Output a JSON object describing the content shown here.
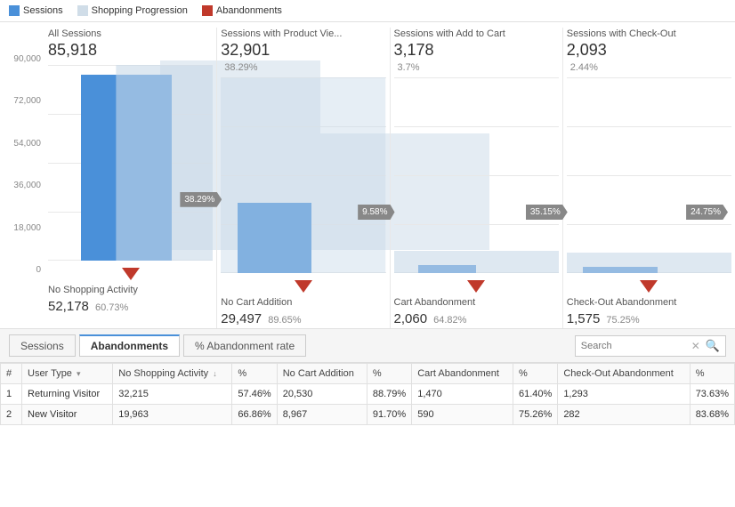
{
  "legend": {
    "sessions_label": "Sessions",
    "shopping_label": "Shopping Progression",
    "abandonment_label": "Abandonments"
  },
  "y_axis": [
    "90,000",
    "72,000",
    "54,000",
    "36,000",
    "18,000",
    "0"
  ],
  "columns": [
    {
      "header": "All Sessions",
      "count": "85,918",
      "pct": "",
      "bar_height_pct": 95,
      "funnel_pct": null,
      "arrow_label": null,
      "bottom_label": "No Shopping Activity",
      "bottom_count": "52,178",
      "bottom_pct": "60.73%",
      "abandon_pct": "38.29%"
    },
    {
      "header": "Sessions with Product Vie...",
      "count": "32,901",
      "pct": "38.29%",
      "bar_height_pct": 36,
      "funnel_pct": null,
      "arrow_label": "9.58%",
      "bottom_label": "No Cart Addition",
      "bottom_count": "29,497",
      "bottom_pct": "89.65%",
      "abandon_pct": "9.58%"
    },
    {
      "header": "Sessions with Add to Cart",
      "count": "3,178",
      "pct": "3.7%",
      "bar_height_pct": 4,
      "funnel_pct": null,
      "arrow_label": "35.15%",
      "bottom_label": "Cart Abandonment",
      "bottom_count": "2,060",
      "bottom_pct": "64.82%",
      "abandon_pct": "35.15%"
    },
    {
      "header": "Sessions with Check-Out",
      "count": "2,093",
      "pct": "2.44%",
      "bar_height_pct": 3,
      "funnel_pct": null,
      "arrow_label": "24.75%",
      "bottom_label": "Check-Out Abandonment",
      "bottom_count": "1,575",
      "bottom_pct": "75.25%",
      "abandon_pct": "24.75%"
    }
  ],
  "tabs": [
    "Sessions",
    "Abandonments",
    "% Abandonment rate"
  ],
  "active_tab": "Abandonments",
  "search_placeholder": "Search",
  "table": {
    "headers": [
      "#",
      "User Type",
      "No Shopping Activity",
      "",
      "No Cart Addition",
      "%",
      "Cart Abandonment",
      "%",
      "Check-Out Abandonment",
      "%"
    ],
    "sort_col": "No Shopping Activity",
    "rows": [
      {
        "num": "1",
        "user_type": "Returning Visitor",
        "no_shopping": "32,215",
        "no_shopping_pct": "57.46%",
        "no_cart": "20,530",
        "no_cart_pct": "88.79%",
        "cart_abandon": "1,470",
        "cart_abandon_pct": "61.40%",
        "checkout_abandon": "1,293",
        "checkout_abandon_pct": "73.63%"
      },
      {
        "num": "2",
        "user_type": "New Visitor",
        "no_shopping": "19,963",
        "no_shopping_pct": "66.86%",
        "no_cart": "8,967",
        "no_cart_pct": "91.70%",
        "cart_abandon": "590",
        "cart_abandon_pct": "75.26%",
        "checkout_abandon": "282",
        "checkout_abandon_pct": "83.68%"
      }
    ]
  }
}
